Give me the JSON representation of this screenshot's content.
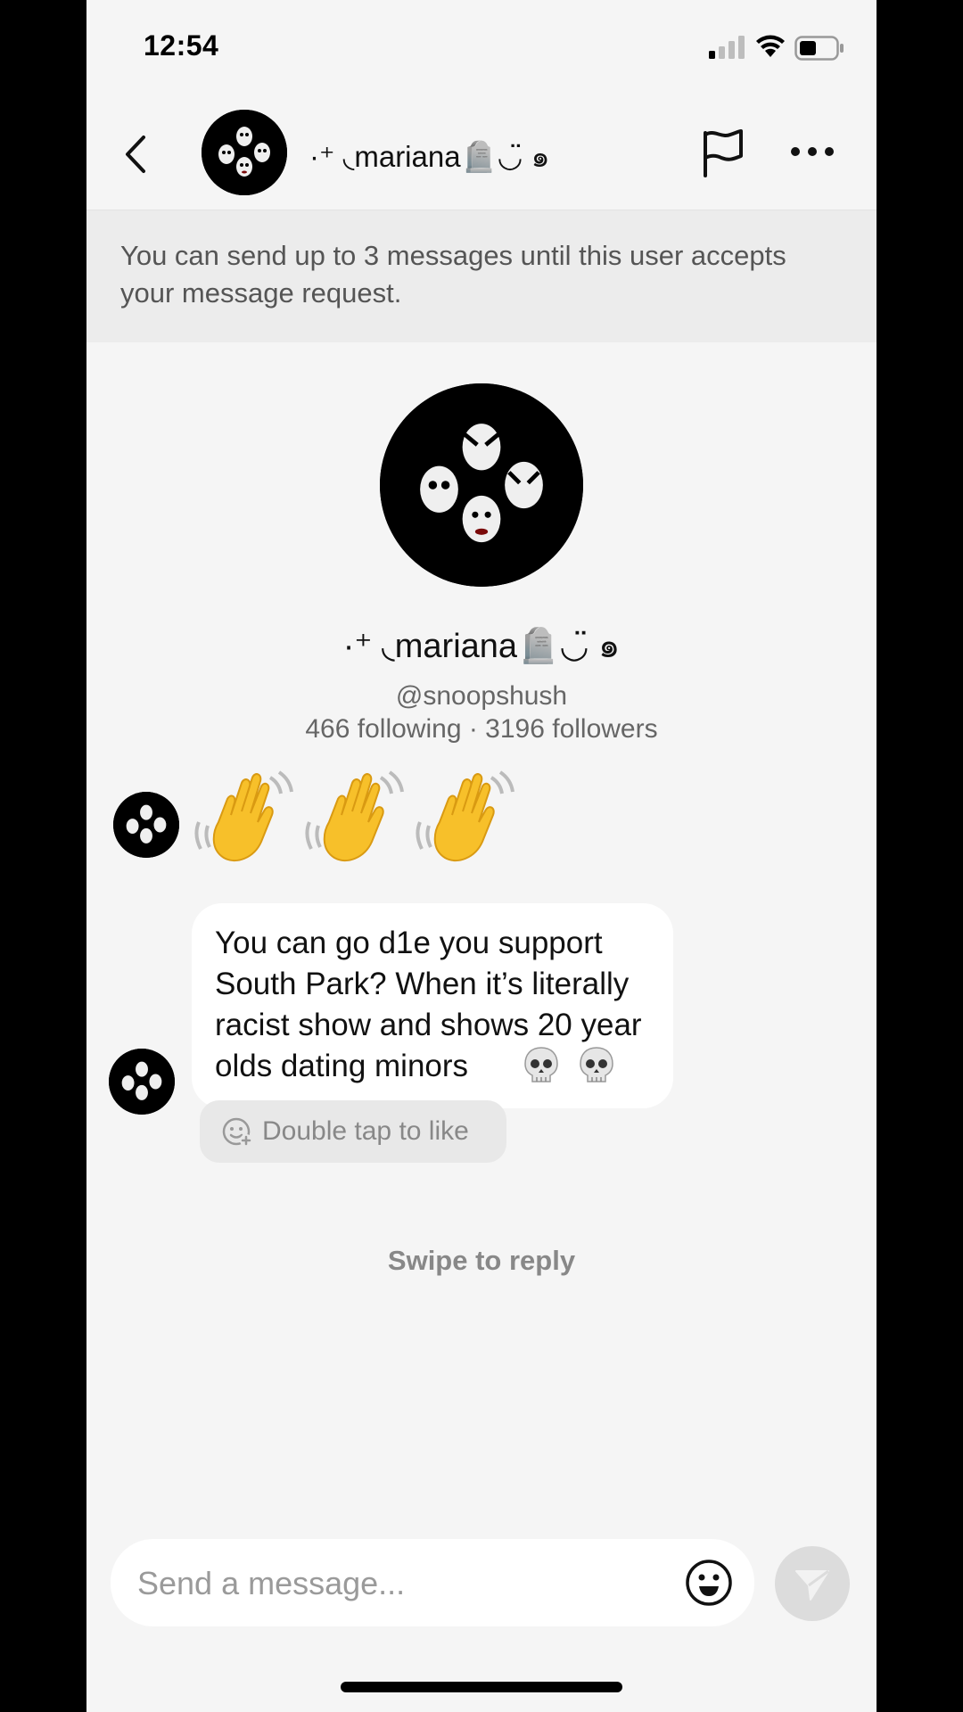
{
  "status_bar": {
    "time": "12:54"
  },
  "header": {
    "contact_name": "·⁺ ◟mariana🪦◡̈ ๑",
    "back_icon": "chevron-left-icon",
    "flag_icon": "flag-icon",
    "more_icon": "more-horizontal-icon"
  },
  "notice": {
    "text": "You can send up to 3 messages until this user accepts your message request."
  },
  "profile": {
    "name": "·⁺ ◟mariana🪦◡̈ ๑",
    "handle": "@snoopshush",
    "stats": "466 following · 3196 followers"
  },
  "messages": [
    {
      "type": "emoji",
      "content": "👋👋👋"
    },
    {
      "type": "text",
      "content": "You can go d1e you support South Park? When it’s literally racist show and shows 20 year olds dating minors",
      "trailing_emoji": "💀 💀"
    }
  ],
  "like_hint": "Double tap to like",
  "swipe_hint": "Swipe to reply",
  "composer": {
    "placeholder": "Send a message...",
    "value": ""
  },
  "colors": {
    "background": "#f5f5f5",
    "notice_bg": "#ececec",
    "bubble_bg": "#ffffff",
    "send_disabled": "#dcdcdc"
  }
}
